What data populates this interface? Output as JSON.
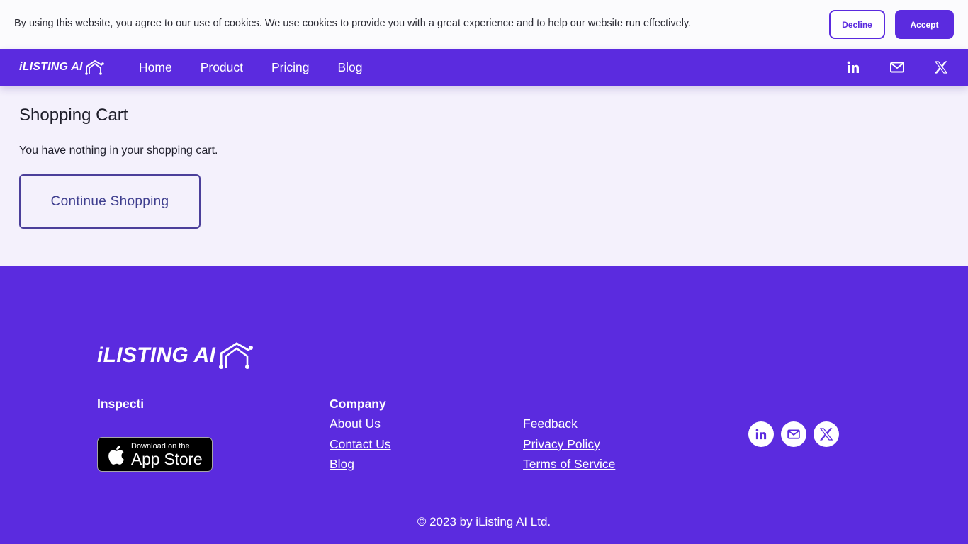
{
  "cookie_banner": {
    "message": "By using this website, you agree to our use of cookies. We use cookies to provide you with a great experience and to help our website run effectively.",
    "decline_label": "Decline",
    "accept_label": "Accept"
  },
  "header": {
    "logo_text": "iLISTING AI",
    "nav": [
      "Home",
      "Product",
      "Pricing",
      "Blog"
    ],
    "social_icons": [
      "linkedin-icon",
      "mail-icon",
      "x-icon"
    ]
  },
  "main": {
    "title": "Shopping Cart",
    "empty_message": "You have nothing in your shopping cart.",
    "continue_label": "Continue Shopping"
  },
  "footer": {
    "logo_text": "iLISTING AI",
    "brand_link": "Inspecti",
    "app_store": {
      "small": "Download on the",
      "big": "App Store"
    },
    "company_heading": "Company",
    "company_links": [
      "About Us",
      "Contact Us",
      "Blog"
    ],
    "legal_links": [
      "Feedback",
      "Privacy Policy",
      "Terms of Service"
    ],
    "social_icons": [
      "linkedin-icon",
      "mail-icon",
      "x-icon"
    ],
    "copyright": "© 2023 by iListing AI Ltd."
  },
  "colors": {
    "brand": "#5b2bdf",
    "page_background": "#f4f1fc",
    "cookie_background": "#fbfbfd",
    "text": "#1e1e2a",
    "outline_button": "#4b3f9a"
  }
}
